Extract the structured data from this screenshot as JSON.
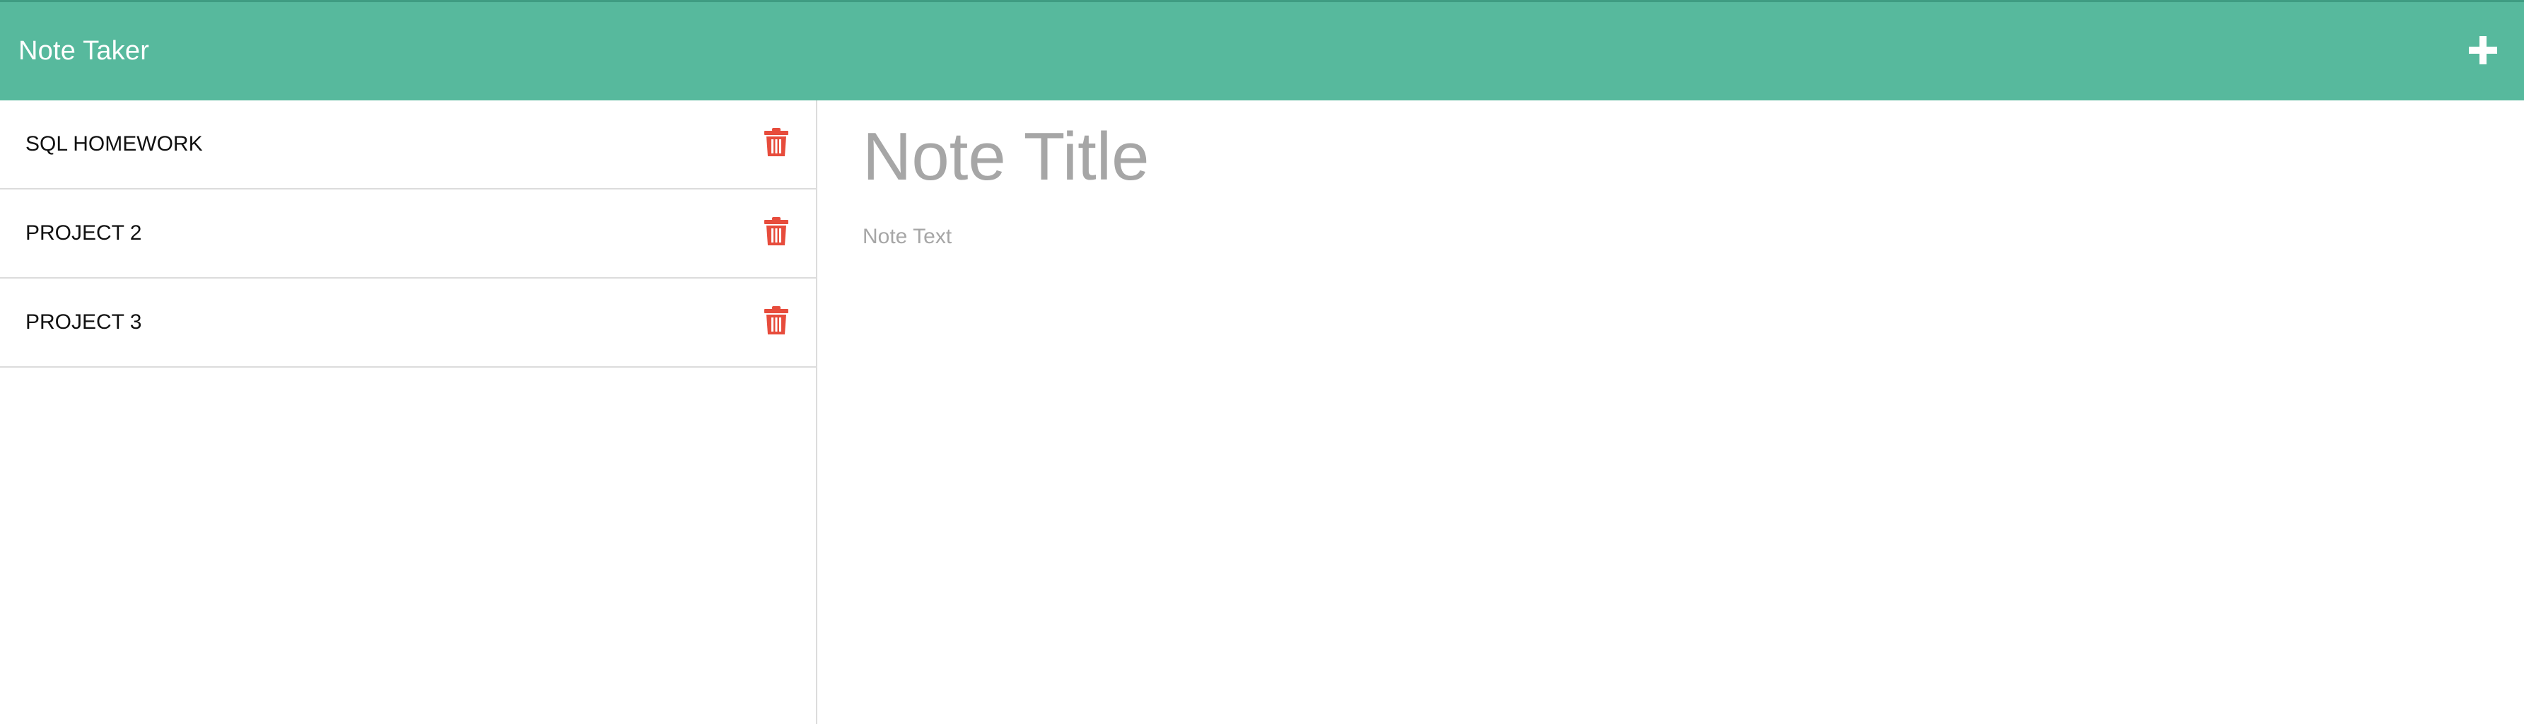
{
  "navbar": {
    "brand": "Note Taker",
    "new_note_icon": "plus-icon",
    "background_color": "#57b99d"
  },
  "sidebar": {
    "notes": [
      {
        "title": "SQL HOMEWORK",
        "delete_icon": "trash-icon"
      },
      {
        "title": "PROJECT 2",
        "delete_icon": "trash-icon"
      },
      {
        "title": "PROJECT 3",
        "delete_icon": "trash-icon"
      }
    ],
    "delete_icon_color": "#e74c3c"
  },
  "editor": {
    "title_placeholder": "Note Title",
    "title_value": "",
    "text_placeholder": "Note Text",
    "text_value": ""
  }
}
